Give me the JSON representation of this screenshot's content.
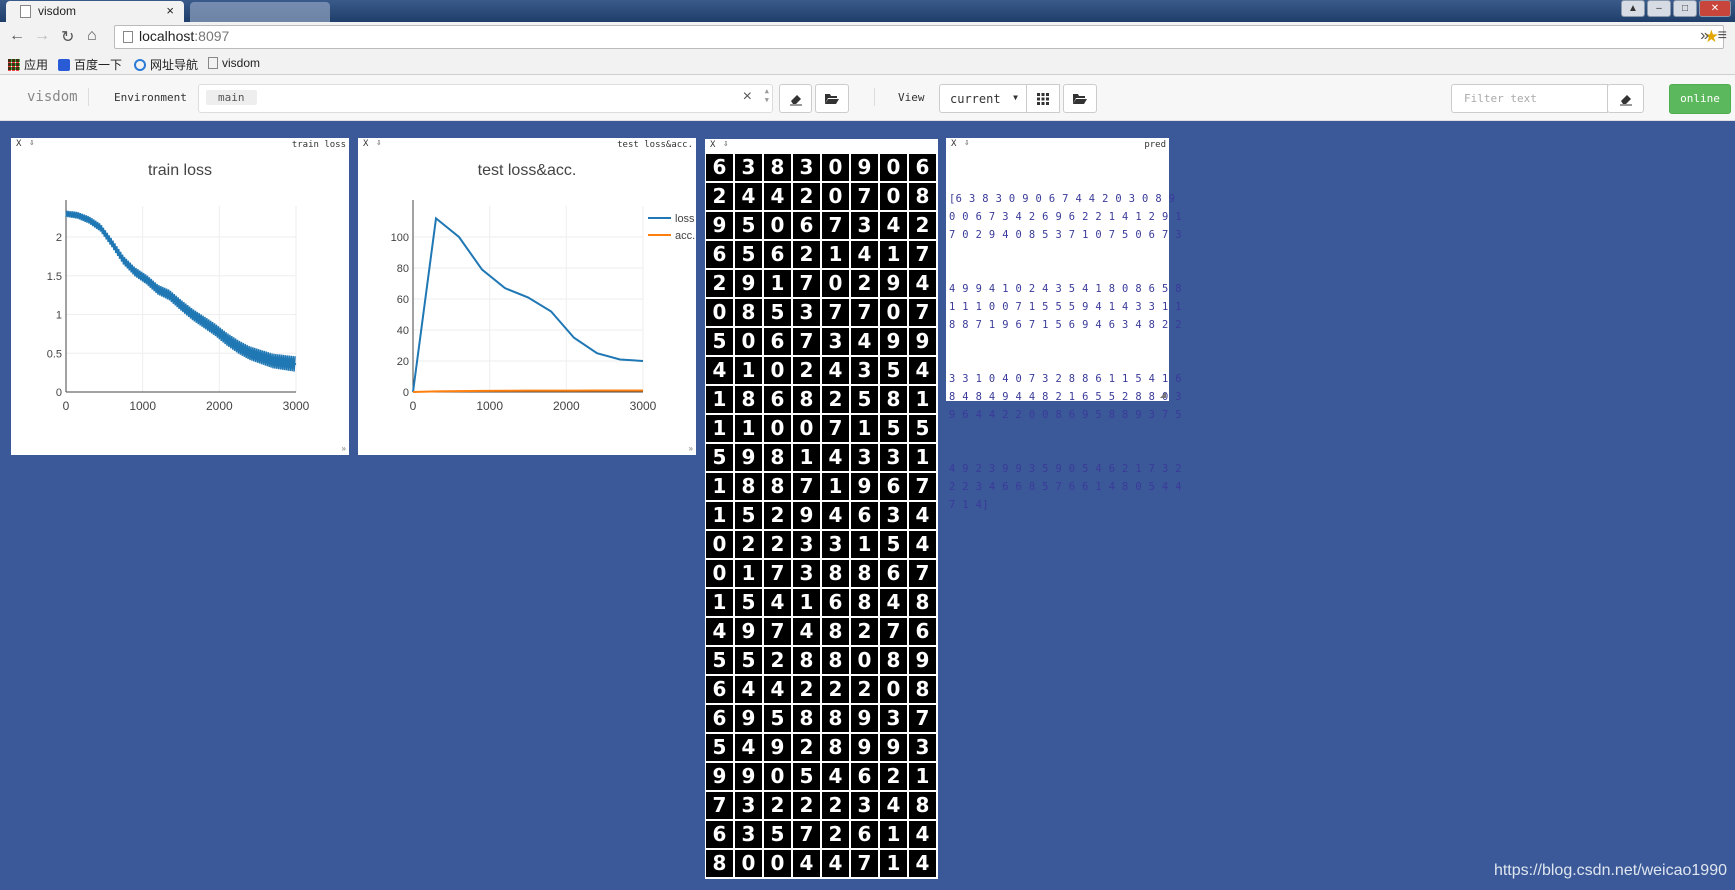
{
  "browser": {
    "tab_title": "visdom",
    "tab_close": "×",
    "url_host": "localhost",
    "url_port": ":8097",
    "bookmarks": [
      "应用",
      "百度一下",
      "网址导航",
      "visdom"
    ],
    "overflow": "»",
    "menu": "≡"
  },
  "header": {
    "brand": "visdom",
    "env_label": "Environment",
    "env_selected": "main",
    "env_clear": "×",
    "view_label": "View",
    "view_selected": "current",
    "filter_placeholder": "Filter text",
    "status": "online"
  },
  "panes": {
    "train_loss": {
      "bar_title": "train loss",
      "close": "X",
      "title": "train loss"
    },
    "test_loss": {
      "bar_title": "test loss&acc.",
      "close": "X",
      "title": "test loss&acc."
    },
    "images": {
      "close": "X"
    },
    "pred": {
      "bar_title": "pred",
      "close": "X",
      "lines": [
        "[6 3 8 3 0 9 0 6 7 4 4 2 0 3 0 8 9",
        "0 0 6 7 3 4 2 6 9 6 2 2 1 4 1 2 9 1",
        "7 0 2 9 4 0 8 5 3 7 1 0 7 5 0 6 7 3",
        "4 9 9 4 1 0 2 4 3 5 4 1 8 0 8 6 5 8",
        "1 1 1 0 0 7 1 5 5 5 9 4 1 4 3 3 1 1",
        "8 8 7 1 9 6 7 1 5 6 9 4 6 3 4 8 2 2",
        "3 3 1 0 4 0 7 3 2 8 8 6 1 1 5 4 1 6",
        "8 4 8 4 9 4 4 8 2 1 6 5 5 2 8 8 0 3",
        "9 6 4 4 2 2 0 0 8 6 9 5 8 8 9 3 7 5",
        "4 9 2 3 9 9 3 5 9 0 5 4 6 2 1 7 3 2",
        "2 2 3 4 6 6 8 5 7 6 6 1 4 8 0 5 4 4",
        "7 1 4]"
      ]
    }
  },
  "digit_grid": [
    "63830906",
    "24420708",
    "95067342",
    "65621417",
    "29170294",
    "08537707",
    "50673499",
    "41024354",
    "18682581",
    "11007155",
    "59814331",
    "18871967",
    "15294634",
    "02233154",
    "01738867",
    "15416848",
    "49748276",
    "55288089",
    "64422208",
    "69588937",
    "54928993",
    "99054621",
    "73222348",
    "63572614",
    "80044714"
  ],
  "chart_data": [
    {
      "type": "line",
      "title": "train loss",
      "xlim": [
        0,
        3000
      ],
      "ylim": [
        0,
        2.4
      ],
      "xticks": [
        "0",
        "1000",
        "2000",
        "3000"
      ],
      "yticks": [
        "0",
        "0.5",
        "1",
        "1.5",
        "2"
      ],
      "x": [
        0,
        150,
        300,
        450,
        600,
        750,
        900,
        1050,
        1200,
        1350,
        1500,
        1650,
        1800,
        1950,
        2100,
        2250,
        2400,
        2550,
        2700,
        2850,
        3000
      ],
      "values": [
        2.3,
        2.28,
        2.22,
        2.12,
        1.92,
        1.7,
        1.55,
        1.45,
        1.32,
        1.25,
        1.12,
        1.0,
        0.9,
        0.8,
        0.68,
        0.58,
        0.5,
        0.45,
        0.4,
        0.38,
        0.36
      ],
      "color": "#1f77b4"
    },
    {
      "type": "line",
      "title": "test loss&acc.",
      "xlim": [
        0,
        3000
      ],
      "ylim": [
        0,
        120
      ],
      "xticks": [
        "0",
        "1000",
        "2000",
        "3000"
      ],
      "yticks": [
        "0",
        "20",
        "40",
        "60",
        "80",
        "100"
      ],
      "legend": "top-right",
      "series": [
        {
          "name": "loss",
          "color": "#1f77b4",
          "x": [
            0,
            300,
            600,
            900,
            1200,
            1500,
            1800,
            2100,
            2400,
            2700,
            3000
          ],
          "values": [
            0,
            112,
            100,
            79,
            67,
            61,
            52,
            35,
            25,
            21,
            20
          ]
        },
        {
          "name": "acc.",
          "color": "#ff7f0e",
          "x": [
            0,
            300,
            600,
            900,
            1200,
            1500,
            1800,
            2100,
            2400,
            2700,
            3000
          ],
          "values": [
            0,
            0.4,
            0.6,
            0.7,
            0.8,
            0.85,
            0.9,
            0.92,
            0.94,
            0.95,
            0.96
          ]
        }
      ]
    }
  ],
  "watermark": "https://blog.csdn.net/weicao1990",
  "colors": {
    "background": "#3b5998",
    "online": "#5cb85c",
    "loss": "#1f77b4",
    "acc": "#ff7f0e"
  }
}
